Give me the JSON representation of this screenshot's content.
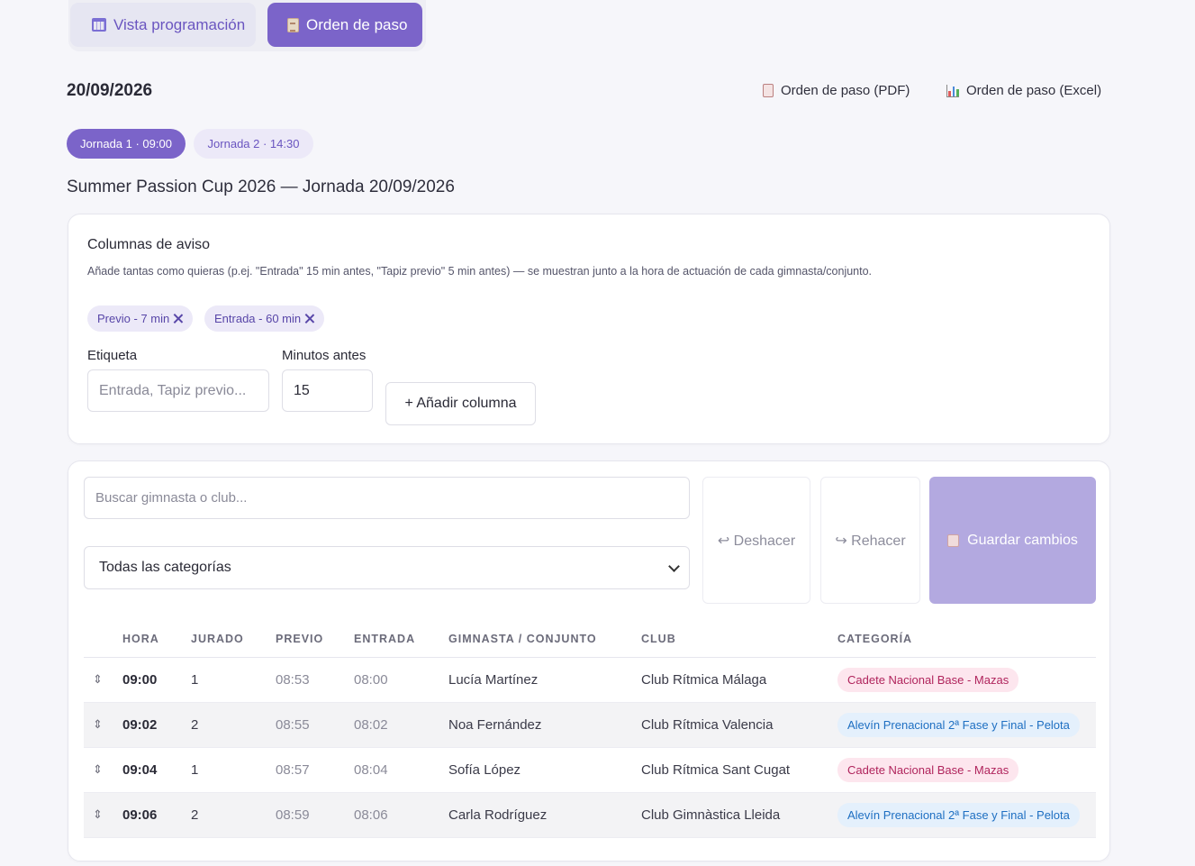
{
  "view_tabs": {
    "schedule_label": "Vista programación",
    "order_label": "Orden de paso"
  },
  "header": {
    "date": "20/09/2026",
    "export_pdf_label": "Orden de paso (PDF)",
    "export_excel_label": "Orden de paso (Excel)"
  },
  "jornadas": [
    {
      "label": "Jornada 1 · 09:00",
      "active": true
    },
    {
      "label": "Jornada 2 · 14:30",
      "active": false
    }
  ],
  "event_title": "Summer Passion Cup 2026 — Jornada 20/09/2026",
  "warning_columns": {
    "title": "Columnas de aviso",
    "description": "Añade tantas como quieras (p.ej. \"Entrada\" 15 min antes, \"Tapiz previo\" 5 min antes) — se muestran junto a la hora de actuación de cada gimnasta/conjunto.",
    "chips": [
      "Previo - 7 min",
      "Entrada - 60 min"
    ],
    "label_field": {
      "label": "Etiqueta",
      "placeholder": "Entrada, Tapiz previo..."
    },
    "minutes_field": {
      "label": "Minutos antes",
      "value": "15"
    },
    "add_button_label": "+ Añadir columna"
  },
  "toolbar": {
    "search_placeholder": "Buscar gimnasta o club...",
    "category_select": "Todas las categorías",
    "undo_label": "↩ Deshacer",
    "redo_label": "↪ Rehacer",
    "save_label": "Guardar cambios"
  },
  "table": {
    "columns": [
      "HORA",
      "JURADO",
      "PREVIO",
      "ENTRADA",
      "GIMNASTA / CONJUNTO",
      "CLUB",
      "CATEGORÍA"
    ],
    "rows": [
      {
        "hora": "09:00",
        "jurado": "1",
        "previo": "08:53",
        "entrada": "08:00",
        "gimnasta": "Lucía Martínez",
        "club": "Club Rítmica Málaga",
        "categoria": "Cadete Nacional Base - Mazas",
        "badge_color": "#b0245c"
      },
      {
        "hora": "09:02",
        "jurado": "2",
        "previo": "08:55",
        "entrada": "08:02",
        "gimnasta": "Noa Fernández",
        "club": "Club Rítmica Valencia",
        "categoria": "Alevín Prenacional 2ª Fase y Final - Pelota",
        "badge_color": "#1e6fc2"
      },
      {
        "hora": "09:04",
        "jurado": "1",
        "previo": "08:57",
        "entrada": "08:04",
        "gimnasta": "Sofía López",
        "club": "Club Rítmica Sant Cugat",
        "categoria": "Cadete Nacional Base - Mazas",
        "badge_color": "#b0245c"
      },
      {
        "hora": "09:06",
        "jurado": "2",
        "previo": "08:59",
        "entrada": "08:06",
        "gimnasta": "Carla Rodríguez",
        "club": "Club Gimnàstica Lleida",
        "categoria": "Alevín Prenacional 2ª Fase y Final - Pelota",
        "badge_color": "#1e6fc2"
      }
    ]
  },
  "colors": {
    "accent": "#7b64c9",
    "accent_light": "#b3a9e0"
  }
}
